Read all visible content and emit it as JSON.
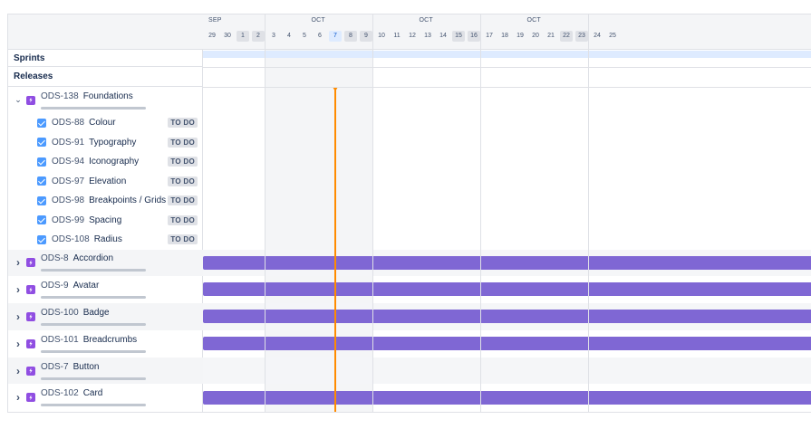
{
  "sections": {
    "sprints": "Sprints",
    "releases": "Releases"
  },
  "timeline": {
    "months": [
      {
        "label": "SEP",
        "days": [
          "29",
          "30",
          "1",
          "2"
        ],
        "weekend": [
          2,
          3
        ]
      },
      {
        "label": "OCT",
        "days": [
          "3",
          "4",
          "5",
          "6",
          "7",
          "8",
          "9"
        ],
        "weekend": [
          5,
          6
        ],
        "today": 4
      },
      {
        "label": "OCT",
        "days": [
          "10",
          "11",
          "12",
          "13",
          "14",
          "15",
          "16"
        ],
        "weekend": [
          5,
          6
        ]
      },
      {
        "label": "OCT",
        "days": [
          "17",
          "18",
          "19",
          "20",
          "21",
          "22",
          "23"
        ],
        "weekend": [
          5,
          6
        ]
      },
      {
        "label": "",
        "days": [
          "24",
          "25"
        ],
        "weekend": []
      }
    ]
  },
  "expanded_epic": {
    "key": "ODS-138",
    "title": "Foundations",
    "expanded": true,
    "children": [
      {
        "key": "ODS-88",
        "title": "Colour",
        "status": "TO DO"
      },
      {
        "key": "ODS-91",
        "title": "Typography",
        "status": "TO DO"
      },
      {
        "key": "ODS-94",
        "title": "Iconography",
        "status": "TO DO"
      },
      {
        "key": "ODS-97",
        "title": "Elevation",
        "status": "TO DO"
      },
      {
        "key": "ODS-98",
        "title": "Breakpoints / Grids",
        "status": "TO DO"
      },
      {
        "key": "ODS-99",
        "title": "Spacing",
        "status": "TO DO"
      },
      {
        "key": "ODS-108",
        "title": "Radius",
        "status": "TO DO"
      }
    ]
  },
  "epics": [
    {
      "key": "ODS-8",
      "title": "Accordion",
      "has_bar": true
    },
    {
      "key": "ODS-9",
      "title": "Avatar",
      "has_bar": true
    },
    {
      "key": "ODS-100",
      "title": "Badge",
      "has_bar": true
    },
    {
      "key": "ODS-101",
      "title": "Breadcrumbs",
      "has_bar": true
    },
    {
      "key": "ODS-7",
      "title": "Button",
      "has_bar": false
    },
    {
      "key": "ODS-102",
      "title": "Card",
      "has_bar": true
    }
  ],
  "icons": {
    "epic": "lightning-icon",
    "task": "checkbox-icon",
    "expand": "chevron-right-icon",
    "collapse": "chevron-down-icon"
  },
  "colors": {
    "epic_bar": "#7f67d4",
    "epic_icon": "#904ee2",
    "today_line": "#ff8b00",
    "sprint_bar": "#deebff"
  }
}
